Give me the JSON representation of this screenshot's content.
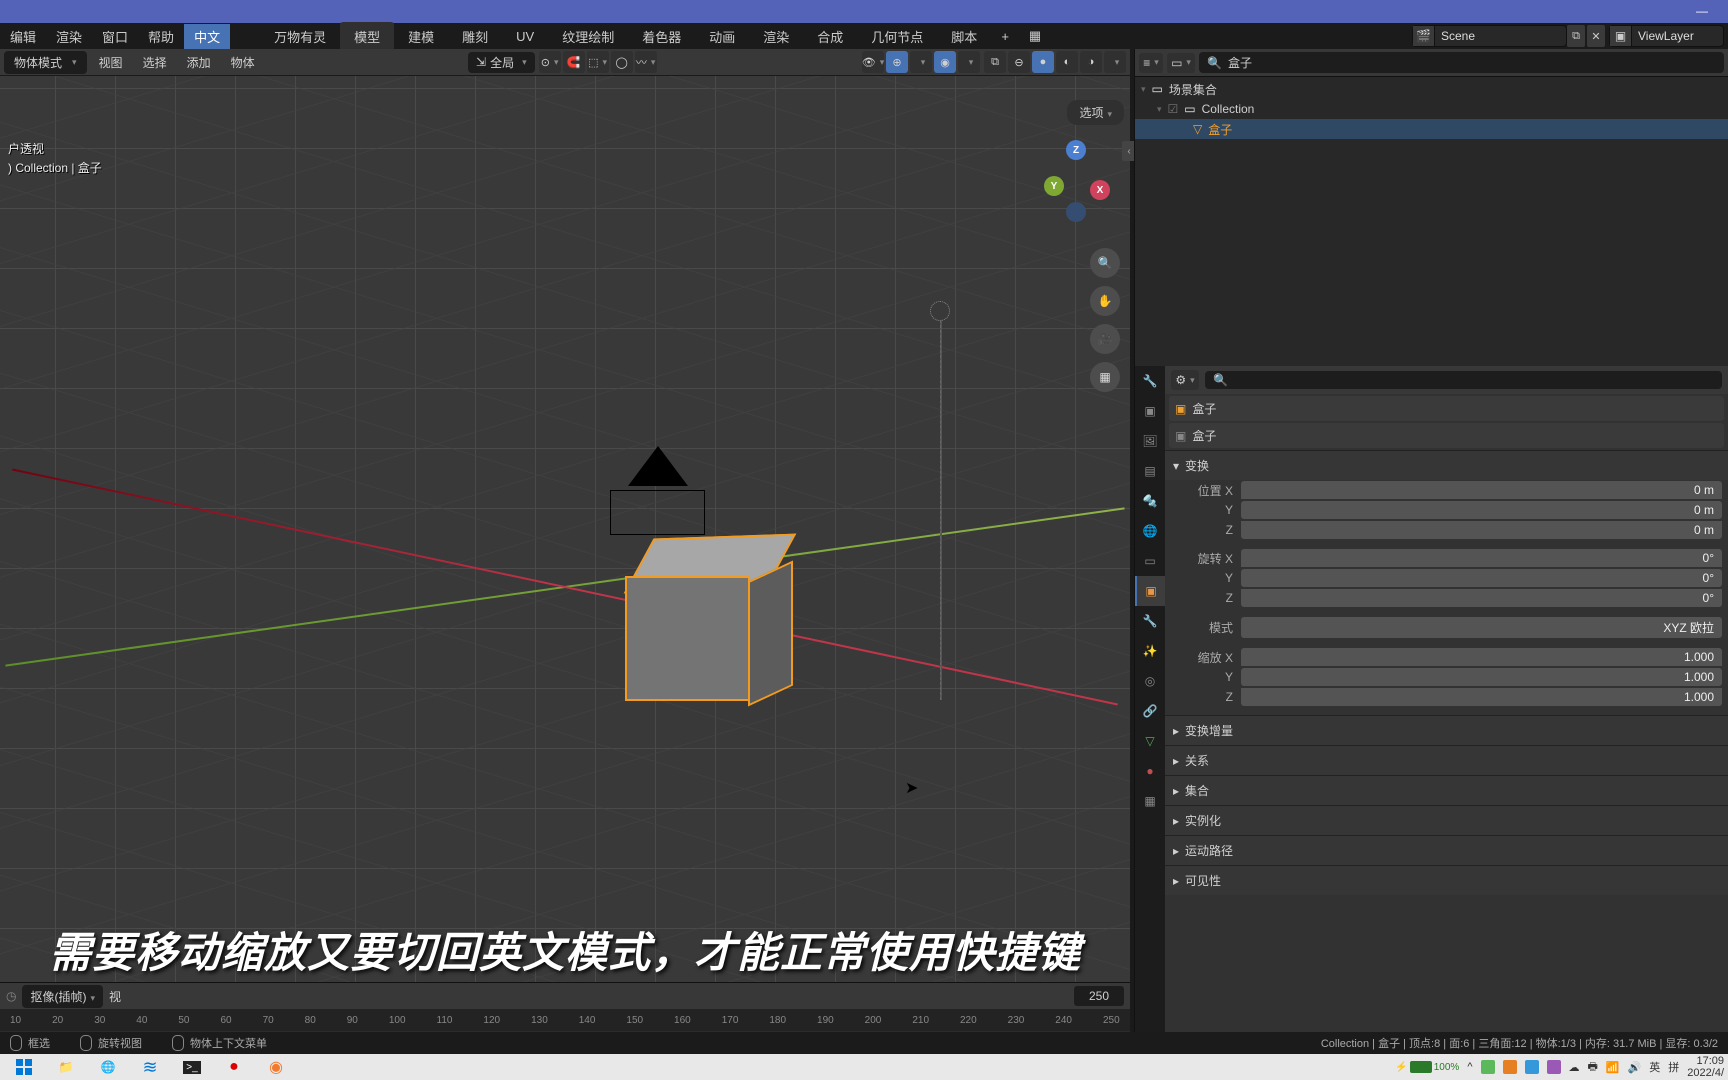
{
  "window": {
    "minimize": "—"
  },
  "mainmenu": [
    "编辑",
    "渲染",
    "窗口",
    "帮助",
    "中文"
  ],
  "workspaces": [
    "万物有灵",
    "模型",
    "建模",
    "雕刻",
    "UV",
    "纹理绘制",
    "着色器",
    "动画",
    "渲染",
    "合成",
    "几何节点",
    "脚本"
  ],
  "active_workspace": 1,
  "scene": {
    "label": "Scene",
    "layer": "ViewLayer"
  },
  "viewport": {
    "mode": "物体模式",
    "menus": [
      "视图",
      "选择",
      "添加",
      "物体"
    ],
    "orientation": "全局",
    "overlay_l1": "户透视",
    "overlay_l2": ") Collection | 盒子",
    "options": "选项"
  },
  "outliner": {
    "search": "盒子",
    "scene_coll": "场景集合",
    "collection": "Collection",
    "object": "盒子"
  },
  "properties": {
    "search": "",
    "object_name": "盒子",
    "data_name": "盒子",
    "panels": {
      "transform": "变换",
      "delta": "变换增量",
      "relations": "关系",
      "collections": "集合",
      "instancing": "实例化",
      "motion": "运动路径",
      "visibility": "可见性"
    },
    "transform": {
      "loc_label": "位置",
      "rot_label": "旋转",
      "scale_label": "缩放",
      "mode_label": "模式",
      "mode_value": "XYZ 欧拉",
      "X": "X",
      "Y": "Y",
      "Z": "Z",
      "loc": {
        "x": "0 m",
        "y": "0 m",
        "z": "0 m"
      },
      "rot": {
        "x": "0°",
        "y": "0°",
        "z": "0°"
      },
      "scale": {
        "x": "1.000",
        "y": "1.000",
        "z": "1.000"
      }
    }
  },
  "timeline": {
    "mode": "抠像(插帧)",
    "menus": [
      "视"
    ],
    "end_box": "250",
    "start_tick": "10",
    "ticks": [
      "10",
      "20",
      "30",
      "40",
      "50",
      "60",
      "70",
      "80",
      "90",
      "100",
      "110",
      "120",
      "130",
      "140",
      "150",
      "160",
      "170",
      "180",
      "190",
      "200",
      "210",
      "220",
      "230",
      "240",
      "250"
    ]
  },
  "status": {
    "left1": "框选",
    "left2": "旋转视图",
    "left3": "物体上下文菜单",
    "right": "Collection | 盒子 | 顶点:8 | 面:6 | 三角面:12 | 物体:1/3 | 内存: 31.7 MiB | 显存: 0.3/2"
  },
  "subtitle": "需要移动缩放又要切回英文模式，才能正常使用快捷键",
  "taskbar": {
    "battery": "100%",
    "ime1": "英",
    "ime2": "拼",
    "time": "17:09",
    "date": "2022/4/"
  }
}
